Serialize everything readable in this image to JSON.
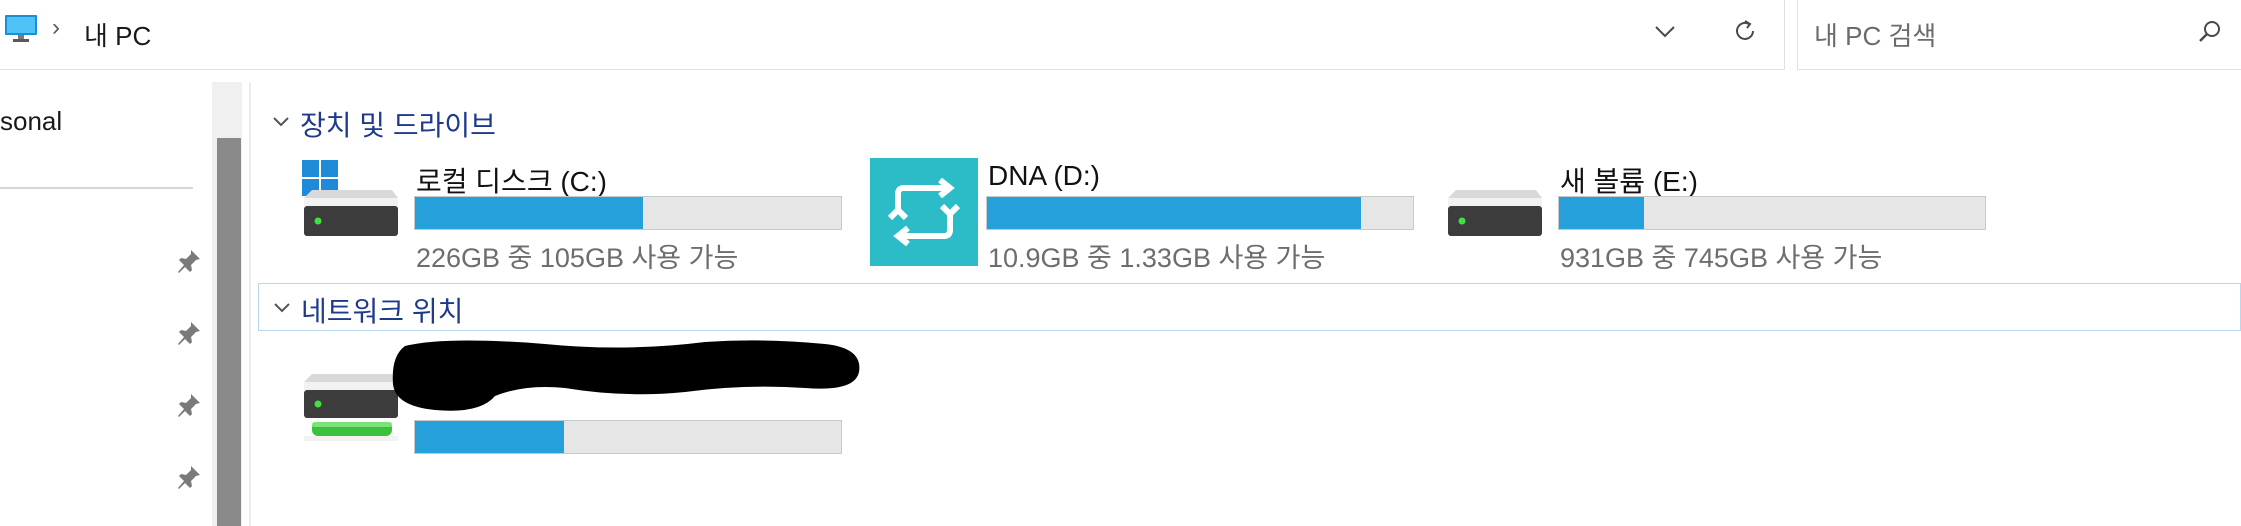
{
  "addressbar": {
    "breadcrumb_sep": "›",
    "location": "내 PC"
  },
  "search": {
    "placeholder": "내 PC 검색"
  },
  "sidebar": {
    "partial_item": "sonal",
    "pinned_count": 4
  },
  "groups": {
    "devices_label": "장치 및 드라이브",
    "network_label": "네트워크 위치"
  },
  "drives": [
    {
      "name": "로컬 디스크 (C:)",
      "info": "226GB 중 105GB 사용 가능",
      "used_fraction": 0.535,
      "icon": "windows-drive-icon"
    },
    {
      "name": "DNA (D:)",
      "info": "10.9GB 중 1.33GB 사용 가능",
      "used_fraction": 0.878,
      "icon": "sync-drive-icon"
    },
    {
      "name": "새 볼륨 (E:)",
      "info": "931GB 중 745GB 사용 가능",
      "used_fraction": 0.2,
      "icon": "hard-drive-icon"
    }
  ],
  "network_drive": {
    "used_fraction": 0.35,
    "icon": "network-drive-icon"
  },
  "colors": {
    "accent": "#26a0da",
    "group_header_text": "#1f3a8c",
    "sync_tile": "#2bbcc8"
  }
}
